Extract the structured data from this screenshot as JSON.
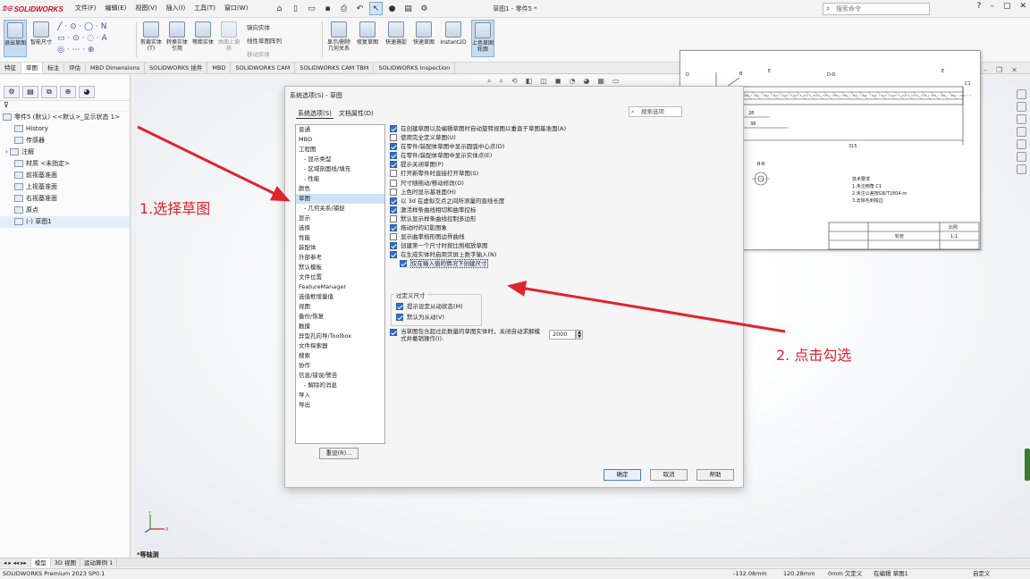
{
  "app": {
    "logo": "SOLIDWORKS",
    "window_title": "草图1 - 零件5 *",
    "search_placeholder": "搜索命令",
    "menus": [
      "文件(F)",
      "编辑(E)",
      "视图(V)",
      "插入(I)",
      "工具(T)",
      "窗口(W)"
    ],
    "window_controls": [
      "?",
      "–",
      "▢",
      "✕"
    ]
  },
  "ribbon": {
    "buttons": [
      "退出草图",
      "智能尺寸",
      "剪裁实体(T)",
      "转换实体引用",
      "等距实体",
      "曲面上偏移",
      "显示/删除几何关系",
      "修复草图",
      "快速捕捉",
      "快速草图",
      "Instant2D",
      "上色草图轮廓"
    ],
    "small": [
      "镜向实体",
      "线性草图阵列",
      "移动实体"
    ],
    "tabs": [
      "特征",
      "草图",
      "标注",
      "评估",
      "MBD Dimensions",
      "SOLIDWORKS 插件",
      "MBD",
      "SOLIDWORKS CAM",
      "SOLIDWORKS CAM TBM",
      "SOLIDWORKS Inspection"
    ],
    "active_tab": "草图"
  },
  "tree": {
    "root": "零件5 (默认) <<默认>_显示状态 1>",
    "items": [
      "History",
      "传感器",
      "注解",
      "材质 <未指定>",
      "前视基准面",
      "上视基准面",
      "右视基准面",
      "原点",
      "(-) 草图1"
    ]
  },
  "dialog": {
    "title": "系统选项(S) - 草图",
    "tabs": [
      "系统选项(S)",
      "文档属性(D)"
    ],
    "search": "搜索选项",
    "categories": [
      "普通",
      "MBD",
      "工程图",
      "- 显示类型",
      "- 区域剖面线/填充",
      "- 性能",
      "颜色",
      "草图",
      "- 几何关系/捕捉",
      "显示",
      "选择",
      "性能",
      "装配体",
      "外部参考",
      "默认模板",
      "文件位置",
      "FeatureManager",
      "选值框增量值",
      "视图",
      "备份/恢复",
      "触摸",
      "异型孔向导/Toolbox",
      "文件探索器",
      "搜索",
      "协作",
      "信息/错误/警告",
      "- 解除的消息",
      "导入",
      "导出"
    ],
    "selected_category": "草图",
    "options": [
      {
        "label": "在创建草图以及编辑草图时自动旋转视图以垂直于草图基准面(A)",
        "checked": true
      },
      {
        "label": "使用完全定义草图(U)",
        "checked": false
      },
      {
        "label": "在零件/装配体草图中显示圆弧中心点(D)",
        "checked": true
      },
      {
        "label": "在零件/装配体草图中显示实体点(E)",
        "checked": true
      },
      {
        "label": "提示关闭草图(P)",
        "checked": true
      },
      {
        "label": "打开新零件时直接打开草图(S)",
        "checked": false
      },
      {
        "label": "尺寸随拖动/移动修改(O)",
        "checked": false
      },
      {
        "label": "上色时显示基准面(H)",
        "checked": false
      },
      {
        "label": "以 3d 在虚拟交点之间所测量的直线长度",
        "checked": true
      },
      {
        "label": "激活样条曲线相切和曲率控标",
        "checked": true
      },
      {
        "label": "默认显示样条曲线控制多边形",
        "checked": false
      },
      {
        "label": "拖动时的幻影图象",
        "checked": true
      },
      {
        "label": "显示曲率梳形图边界曲线",
        "checked": false
      },
      {
        "label": "创建第一个尺寸时按比例缩放草图",
        "checked": true
      },
      {
        "label": "在生成实体时启用荧屏上数字输入(N)",
        "checked": true
      }
    ],
    "sub_option": {
      "label": "仅在输入值的情况下创建尺寸",
      "checked": true
    },
    "overdefine_group": "过定义尺寸",
    "overdefine_options": [
      {
        "label": "提示设定从动状态(M)",
        "checked": true
      },
      {
        "label": "默认为从动(V)",
        "checked": true
      }
    ],
    "entity_option": {
      "label": "当草图包含超过此数量的草图实体时，关闭自动求解模式并撤销操作(I):",
      "checked": true
    },
    "entity_value": "2000",
    "reset_button": "重设(R)...",
    "buttons": [
      "确定",
      "取消",
      "帮助"
    ]
  },
  "annotations": {
    "step1": "1.选择草图",
    "step2": "2. 点击勾选",
    "color": "#e0242f"
  },
  "bottom": {
    "tabs": [
      "模型",
      "3D 视图",
      "运动算例 1"
    ],
    "view_label": "*等轴测",
    "status_app": "SOLIDWORKS Premium 2023 SP0.1",
    "status_x": "-132.08mm",
    "status_y": "120.28mm",
    "status_z": "0mm 欠定义",
    "status_mode": "在编辑 草图1",
    "status_units": "自定义"
  },
  "drawing": {
    "labels": [
      "D-D",
      "B-B",
      "E",
      "E",
      "D",
      "D",
      "B",
      "315",
      "38",
      "28",
      "C1"
    ],
    "title_block": [
      "轮管",
      "比例",
      "1:1"
    ],
    "tech_req": [
      "技术要求",
      "1.未注倒角 C1",
      "2.未注公差按GB/T1804-m",
      "3.去除毛刺锐边"
    ]
  }
}
